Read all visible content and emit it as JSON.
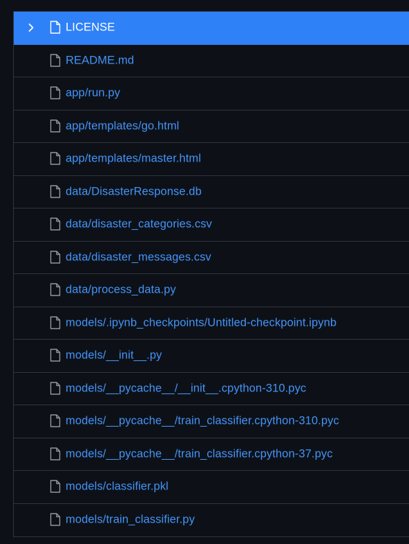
{
  "files": [
    {
      "name": "LICENSE",
      "selected": true
    },
    {
      "name": "README.md",
      "selected": false
    },
    {
      "name": "app/run.py",
      "selected": false
    },
    {
      "name": "app/templates/go.html",
      "selected": false
    },
    {
      "name": "app/templates/master.html",
      "selected": false
    },
    {
      "name": "data/DisasterResponse.db",
      "selected": false
    },
    {
      "name": "data/disaster_categories.csv",
      "selected": false
    },
    {
      "name": "data/disaster_messages.csv",
      "selected": false
    },
    {
      "name": "data/process_data.py",
      "selected": false
    },
    {
      "name": "models/.ipynb_checkpoints/Untitled-checkpoint.ipynb",
      "selected": false
    },
    {
      "name": "models/__init__.py",
      "selected": false
    },
    {
      "name": "models/__pycache__/__init__.cpython-310.pyc",
      "selected": false
    },
    {
      "name": "models/__pycache__/train_classifier.cpython-310.pyc",
      "selected": false
    },
    {
      "name": "models/__pycache__/train_classifier.cpython-37.pyc",
      "selected": false
    },
    {
      "name": "models/classifier.pkl",
      "selected": false
    },
    {
      "name": "models/train_classifier.py",
      "selected": false
    }
  ],
  "icons": {
    "expand": "chevron-right-icon",
    "file": "file-icon"
  },
  "colors": {
    "background": "#0d1117",
    "border": "#30363d",
    "selected_row": "#2f81f7",
    "link": "#4493f8",
    "icon": "#9198a1"
  }
}
